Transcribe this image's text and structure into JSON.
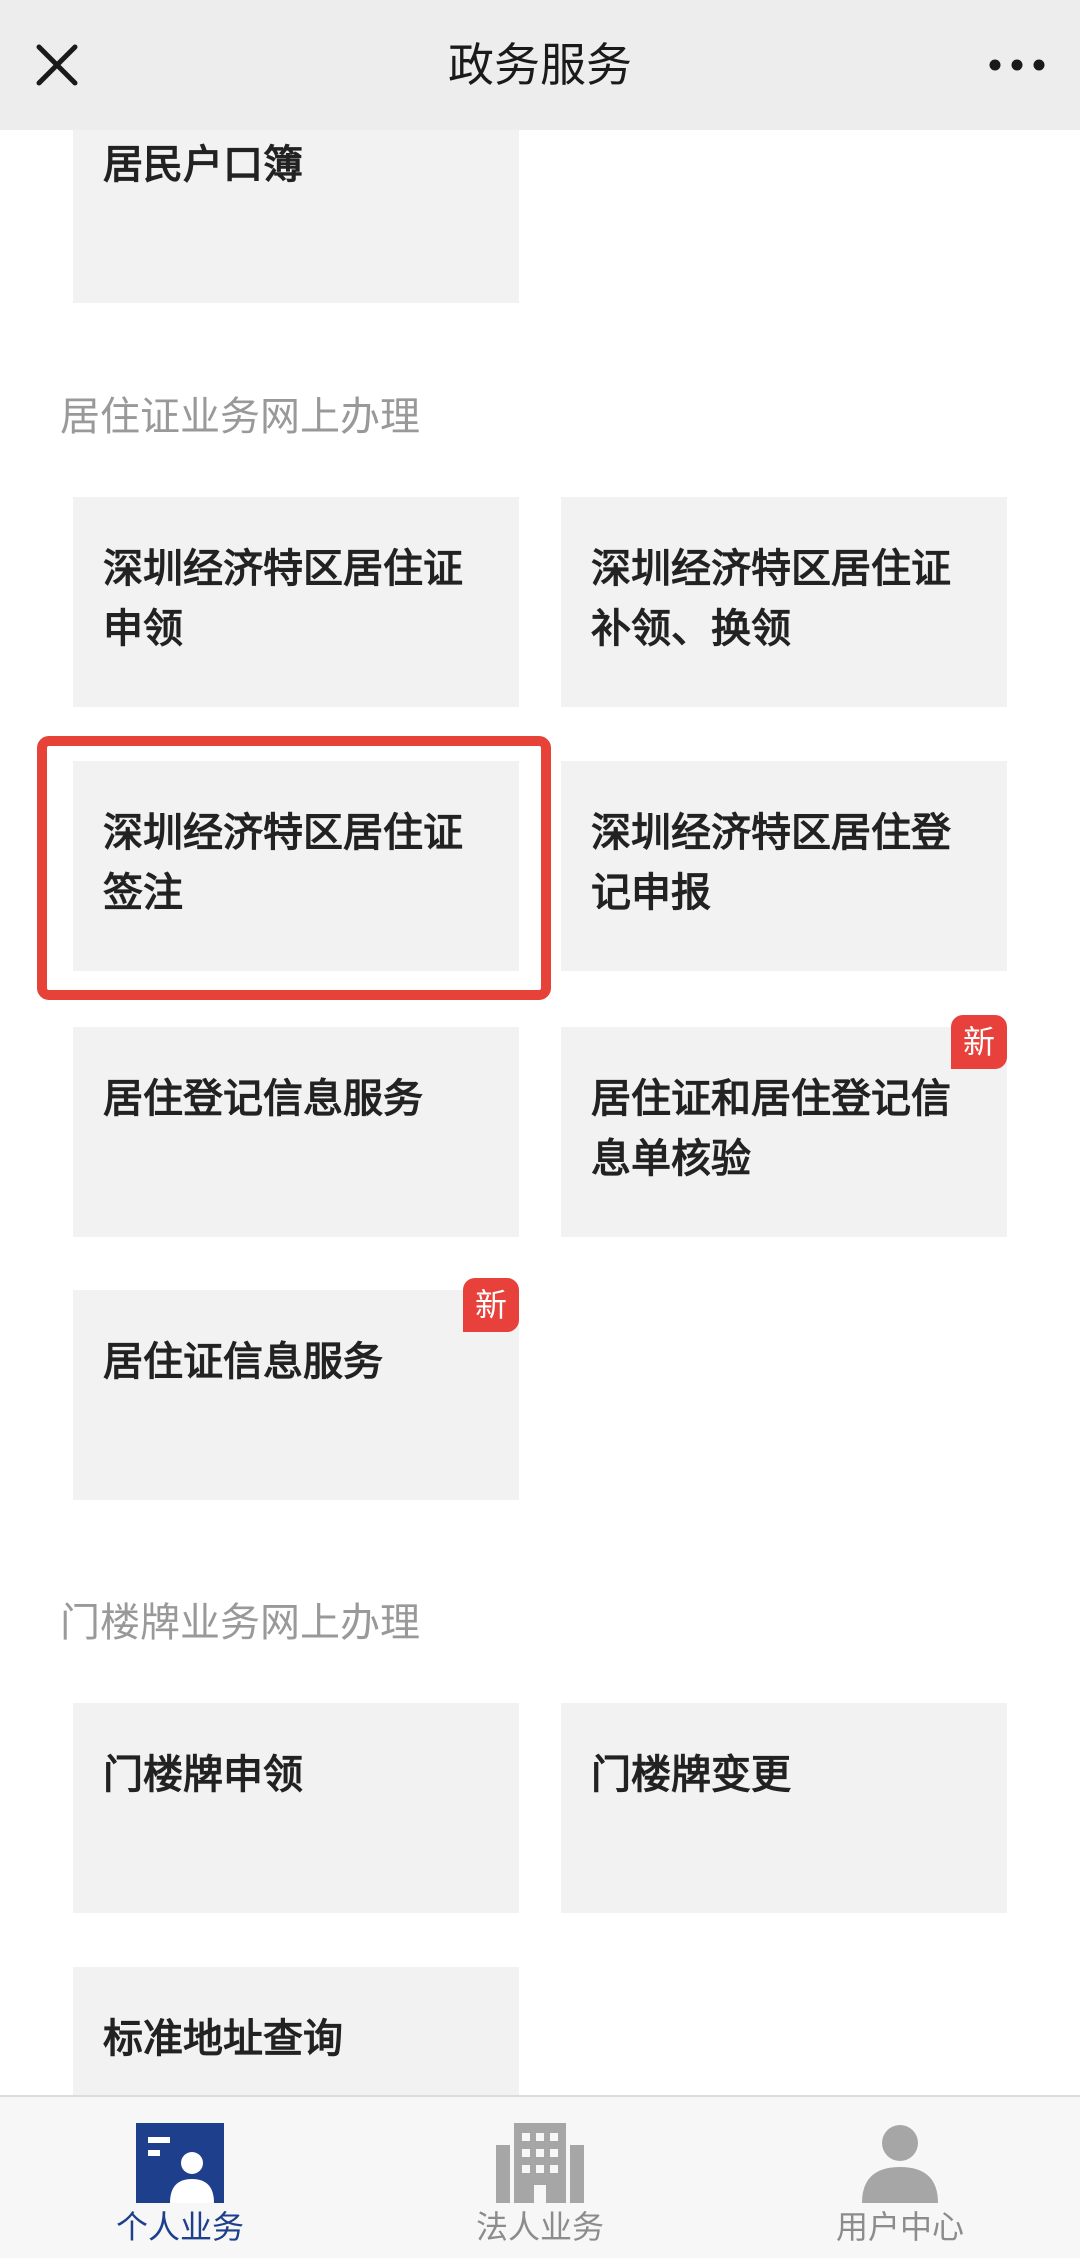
{
  "header": {
    "title": "政务服务",
    "close_icon": "close-icon",
    "more_icon": "more-icon"
  },
  "sections": [
    {
      "title": "",
      "items": [
        {
          "label": "居民户口簿"
        }
      ]
    },
    {
      "title": "居住证业务网上办理",
      "items": [
        {
          "label": "深圳经济特区居住证\n申领"
        },
        {
          "label": "深圳经济特区居住证\n补领、换领"
        },
        {
          "label": "深圳经济特区居住证\n签注",
          "highlighted": true
        },
        {
          "label": "深圳经济特区居住登\n记申报"
        },
        {
          "label": "居住登记信息服务"
        },
        {
          "label": "居住证和居住登记信\n息单核验",
          "badge": "新"
        },
        {
          "label": "居住证信息服务",
          "badge": "新"
        }
      ]
    },
    {
      "title": "门楼牌业务网上办理",
      "items": [
        {
          "label": "门楼牌申领"
        },
        {
          "label": "门楼牌变更"
        },
        {
          "label": "标准地址查询"
        }
      ]
    }
  ],
  "tabs": [
    {
      "label": "个人业务",
      "icon": "person-card-icon",
      "active": true
    },
    {
      "label": "法人业务",
      "icon": "building-icon",
      "active": false
    },
    {
      "label": "用户中心",
      "icon": "user-icon",
      "active": false
    }
  ],
  "colors": {
    "accent": "#1d3f8c",
    "highlight_border": "#e64238",
    "badge": "#e8413b",
    "card_bg": "#f2f2f2"
  }
}
